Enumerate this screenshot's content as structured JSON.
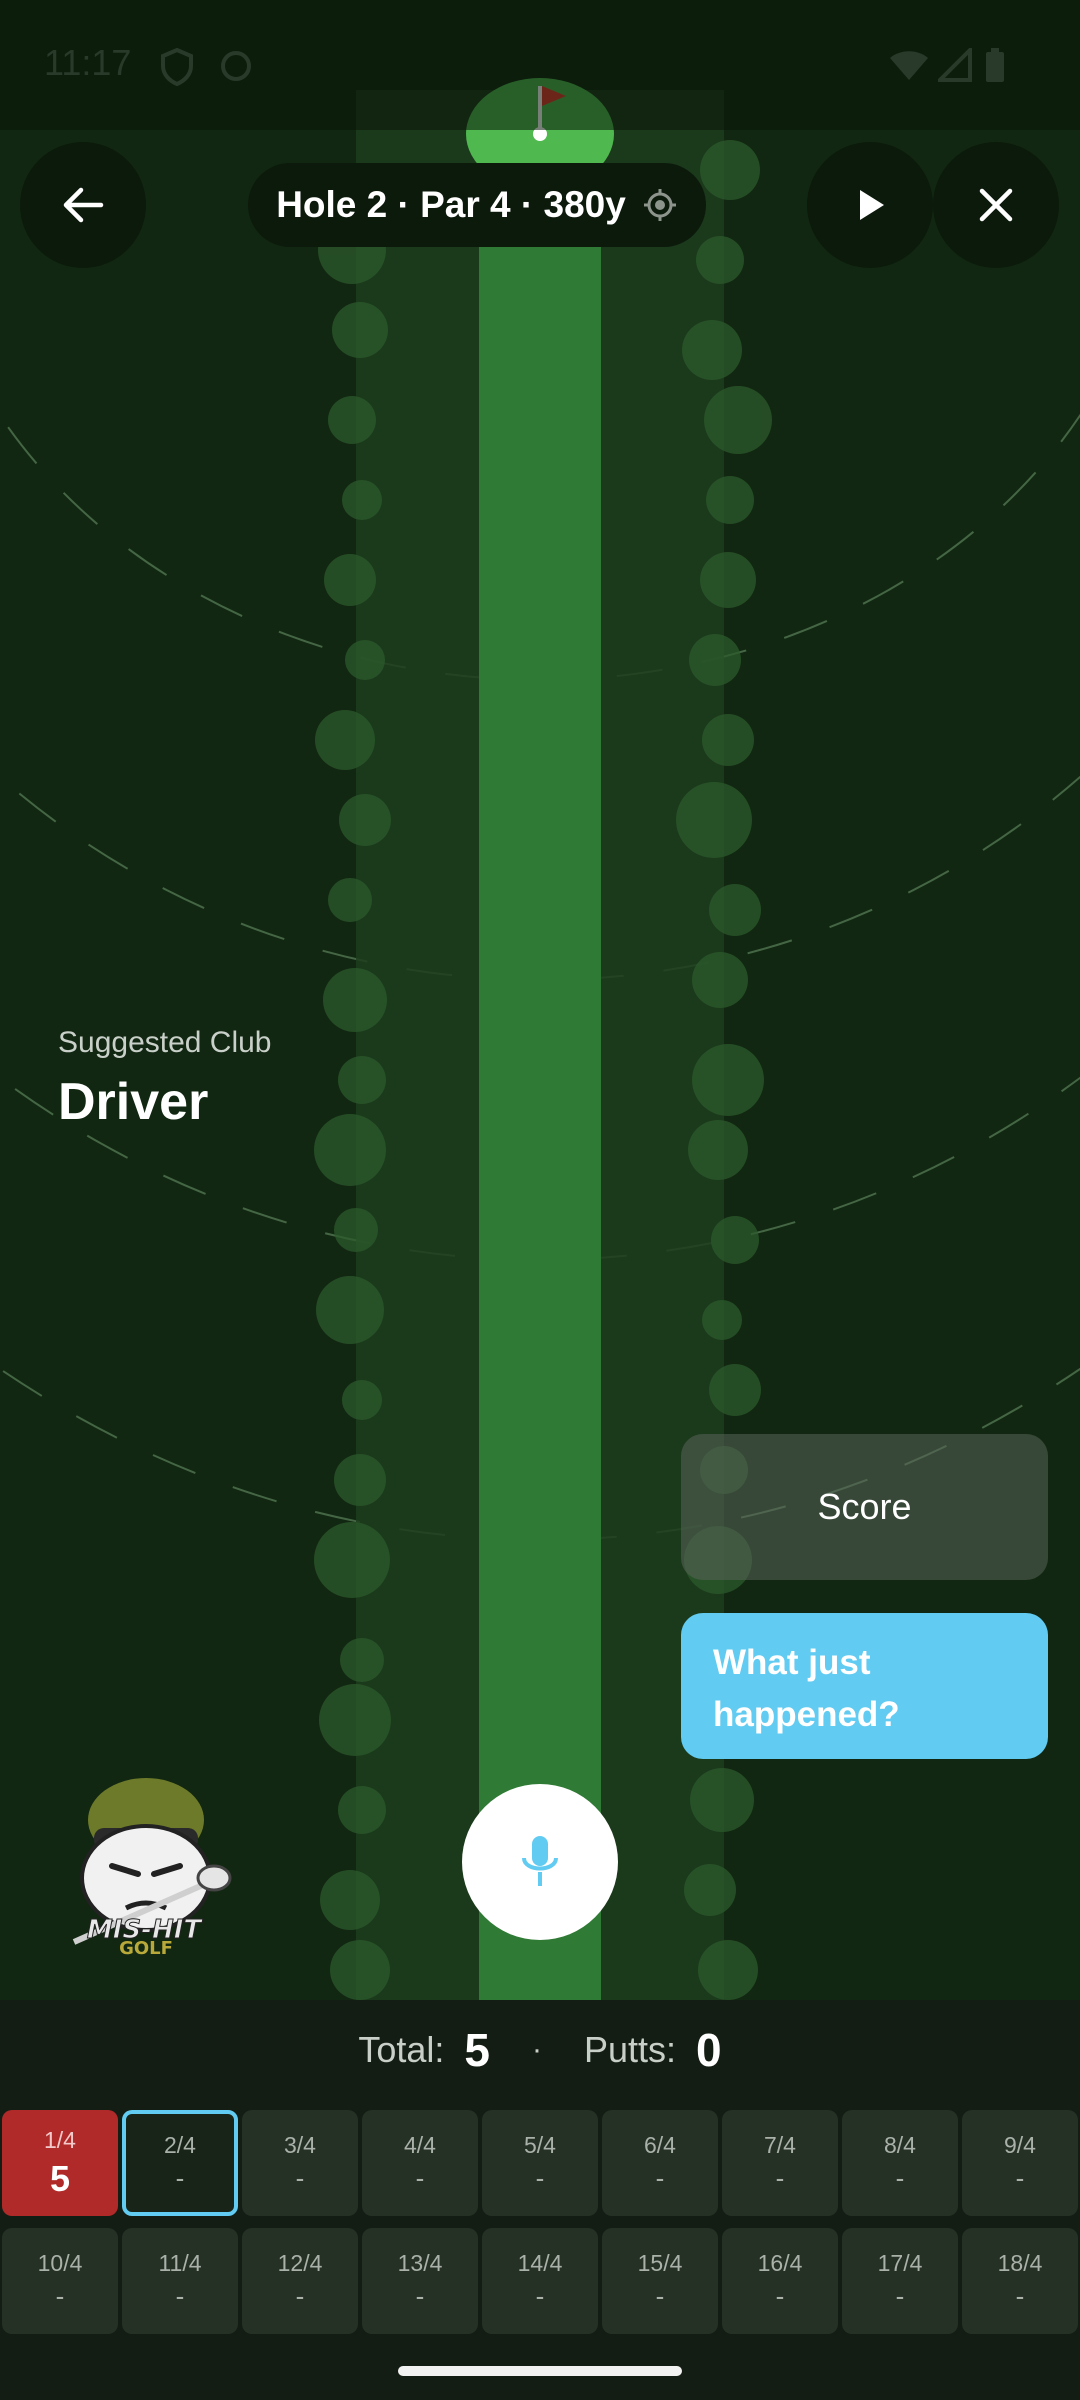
{
  "status_bar": {
    "time": "11:17"
  },
  "header": {
    "hole_info": "Hole 2 · Par 4 · 380y"
  },
  "suggestion": {
    "label": "Suggested Club",
    "club": "Driver"
  },
  "actions": {
    "score_label": "Score",
    "what_happened_label": "What just happened?"
  },
  "totals": {
    "total_label": "Total:",
    "total_value": "5",
    "separator": "·",
    "putts_label": "Putts:",
    "putts_value": "0"
  },
  "holes": [
    {
      "label": "1/4",
      "score": "5"
    },
    {
      "label": "2/4",
      "score": "-"
    },
    {
      "label": "3/4",
      "score": "-"
    },
    {
      "label": "4/4",
      "score": "-"
    },
    {
      "label": "5/4",
      "score": "-"
    },
    {
      "label": "6/4",
      "score": "-"
    },
    {
      "label": "7/4",
      "score": "-"
    },
    {
      "label": "8/4",
      "score": "-"
    },
    {
      "label": "9/4",
      "score": "-"
    },
    {
      "label": "10/4",
      "score": "-"
    },
    {
      "label": "11/4",
      "score": "-"
    },
    {
      "label": "12/4",
      "score": "-"
    },
    {
      "label": "13/4",
      "score": "-"
    },
    {
      "label": "14/4",
      "score": "-"
    },
    {
      "label": "15/4",
      "score": "-"
    },
    {
      "label": "16/4",
      "score": "-"
    },
    {
      "label": "17/4",
      "score": "-"
    },
    {
      "label": "18/4",
      "score": "-"
    }
  ],
  "logo": {
    "text_line1": "MIS-HIT",
    "text_line2": "GOLF"
  },
  "colors": {
    "rough": "#112711",
    "fairway": "#2f7a34",
    "green": "#4fb84f",
    "flag": "#e23b2e",
    "accent": "#62cbf1",
    "played_hole": "#b02a2a"
  },
  "icons": {
    "back": "arrow-left-icon",
    "locate": "crosshair-icon",
    "play": "play-icon",
    "close": "close-icon",
    "mic": "microphone-icon",
    "flag": "flag-icon"
  }
}
